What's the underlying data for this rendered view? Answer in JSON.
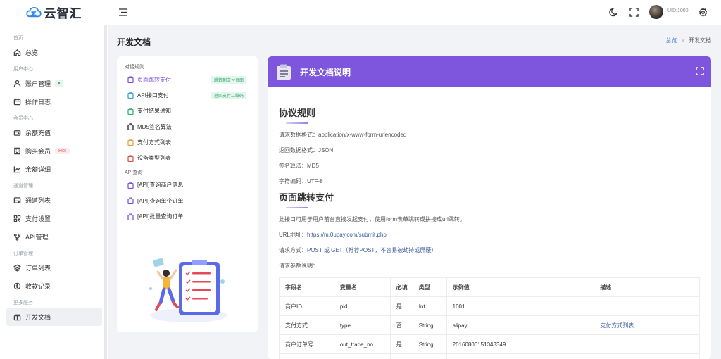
{
  "app": {
    "name": "云智汇"
  },
  "sidebar": {
    "groups": [
      {
        "title": "首页",
        "items": [
          {
            "label": "总览",
            "icon": "home-icon"
          }
        ]
      },
      {
        "title": "用户中心",
        "items": [
          {
            "label": "账户管理",
            "icon": "user-icon",
            "badge": "diamond"
          },
          {
            "label": "操作日志",
            "icon": "calendar-icon"
          }
        ]
      },
      {
        "title": "会员中心",
        "items": [
          {
            "label": "余额充值",
            "icon": "wallet-icon"
          },
          {
            "label": "购买会员",
            "icon": "building-icon",
            "badge": "Hot"
          },
          {
            "label": "余额详细",
            "icon": "chart-icon"
          }
        ]
      },
      {
        "title": "通道管理",
        "items": [
          {
            "label": "通道列表",
            "icon": "drive-icon"
          },
          {
            "label": "支付设置",
            "icon": "grid-icon"
          },
          {
            "label": "API管理",
            "icon": "nodes-icon"
          }
        ]
      },
      {
        "title": "订单管理",
        "items": [
          {
            "label": "订单列表",
            "icon": "layers-icon"
          },
          {
            "label": "收款记录",
            "icon": "coin-icon"
          }
        ]
      },
      {
        "title": "更多服务",
        "items": [
          {
            "label": "开发文档",
            "icon": "box-icon",
            "active": true
          }
        ]
      }
    ]
  },
  "topbar": {
    "uid": "UID:1000"
  },
  "page": {
    "title": "开发文档",
    "breadcrumb": [
      "总览",
      "开发文档"
    ]
  },
  "docs_nav": {
    "groups": [
      {
        "title": "对接规则",
        "items": [
          {
            "label": "页面跳转支付",
            "badge": "跳转到支付页面",
            "color": "#7b57d9",
            "active": true
          },
          {
            "label": "API接口支付",
            "badge": "返回支付二维码",
            "color": "#3aa0d8"
          },
          {
            "label": "支付结果通知",
            "color": "#33b17a"
          },
          {
            "label": "MD5签名算法",
            "color": "#222222"
          },
          {
            "label": "支付方式列表",
            "color": "#e6a23c"
          },
          {
            "label": "设备类型列表",
            "color": "#e05252"
          }
        ]
      },
      {
        "title": "API查询",
        "items": [
          {
            "label": "[API]查询商户信息",
            "color": "#7b57d9"
          },
          {
            "label": "[API]查询单个订单",
            "color": "#7b57d9"
          },
          {
            "label": "[API]批量查询订单",
            "color": "#7b57d9"
          }
        ]
      }
    ]
  },
  "doc": {
    "header": "开发文档说明",
    "protocol": {
      "title": "协议规则",
      "lines": [
        "请求数据格式：application/x-www-form-urlencoded",
        "返回数据格式：JSON",
        "签名算法：MD5",
        "字符编码：UTF-8"
      ]
    },
    "jump": {
      "title": "页面跳转支付",
      "desc": "此接口可用于用户前台直接发起支付，使用form表单跳转或拼接成url跳转。",
      "url_label": "URL地址：",
      "url": "https://m.0upay.com/submit.php",
      "method_label": "请求方式：",
      "method": "POST 或 GET（推荐POST，不容易被劫持或屏蔽）",
      "params_label": "请求参数说明："
    },
    "table": {
      "headers": [
        "字段名",
        "变量名",
        "必填",
        "类型",
        "示例值",
        "描述"
      ],
      "rows": [
        [
          "商户ID",
          "pid",
          "是",
          "Int",
          "1001",
          ""
        ],
        [
          "支付方式",
          "type",
          "否",
          "String",
          "alipay",
          "支付方式列表"
        ],
        [
          "商户订单号",
          "out_trade_no",
          "是",
          "String",
          "20160806151343349",
          ""
        ],
        [
          "",
          "",
          "",
          "",
          "",
          ""
        ]
      ]
    }
  },
  "colors": {
    "accent": "#7e56de",
    "link": "#3e5b9e"
  }
}
